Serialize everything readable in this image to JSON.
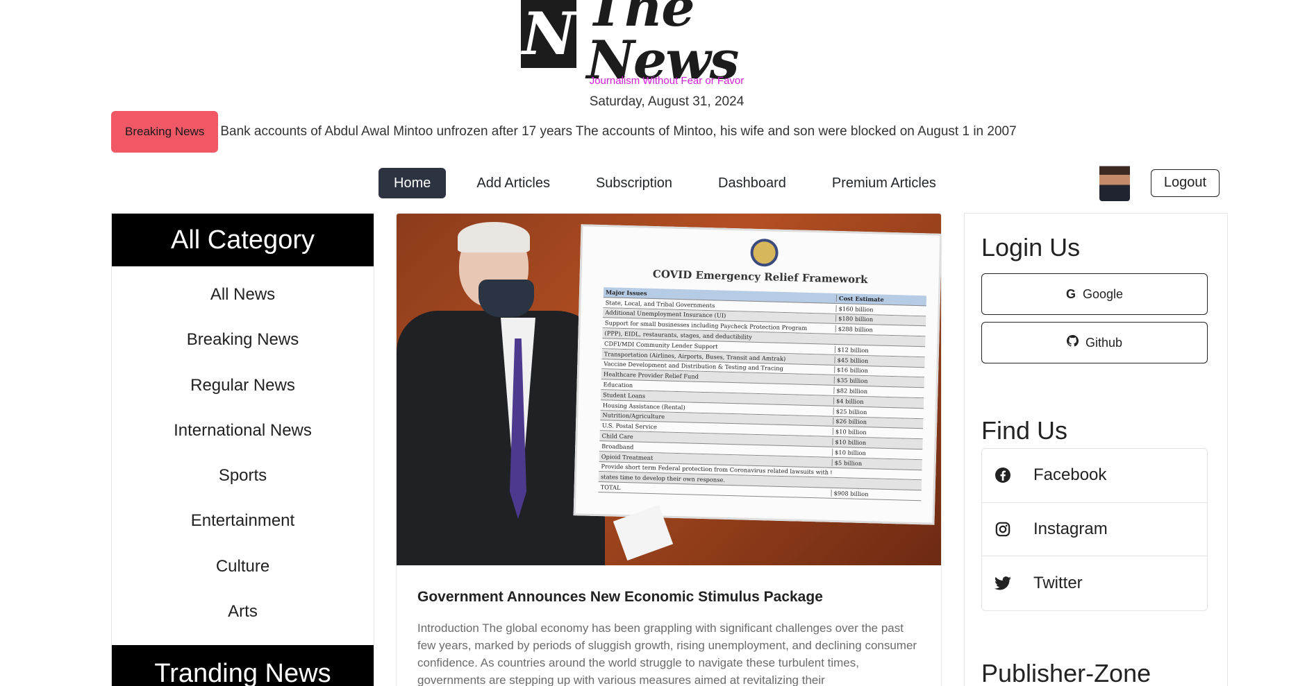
{
  "brand": {
    "logo_letter": "N",
    "logo_name": "The News",
    "tagline": "Journalism Without Fear or Favor",
    "date": "Saturday, August 31, 2024"
  },
  "breaking": {
    "badge": "Breaking News",
    "headline": "Bank accounts of Abdul Awal Mintoo unfrozen after 17 years The accounts of Mintoo, his wife and son were blocked on August 1 in 2007"
  },
  "nav": {
    "items": [
      "Home",
      "Add Articles",
      "Subscription",
      "Dashboard",
      "Premium Articles"
    ],
    "active": "Home",
    "logout_label": "Logout"
  },
  "categories": {
    "heading": "All Category",
    "items": [
      "All News",
      "Breaking News",
      "Regular News",
      "International News",
      "Sports",
      "Entertainment",
      "Culture",
      "Arts"
    ],
    "trending_heading": "Tranding News"
  },
  "article": {
    "image_board": {
      "title": "COVID Emergency Relief Framework",
      "header": [
        "Major Issues",
        "Cost Estimate"
      ],
      "rows": [
        [
          "State, Local, and Tribal Governments",
          "$160 billion"
        ],
        [
          "Additional Unemployment Insurance (UI)",
          "$180 billion"
        ],
        [
          "Support for small businesses including Paycheck Protection Program",
          "$288 billion"
        ],
        [
          "(PPP), EIDL, restaurants, stages, and deductibility",
          ""
        ],
        [
          "CDFI/MDI Community Lender Support",
          "$12 billion"
        ],
        [
          "Transportation (Airlines, Airports, Buses, Transit and Amtrak)",
          "$45 billion"
        ],
        [
          "Vaccine Development and Distribution & Testing and Tracing",
          "$16 billion"
        ],
        [
          "Healthcare Provider Relief Fund",
          "$35 billion"
        ],
        [
          "Education",
          "$82 billion"
        ],
        [
          "Student Loans",
          "$4 billion"
        ],
        [
          "Housing Assistance (Rental)",
          "$25 billion"
        ],
        [
          "Nutrition/Agriculture",
          "$26 billion"
        ],
        [
          "U.S. Postal Service",
          "$10 billion"
        ],
        [
          "Child Care",
          "$10 billion"
        ],
        [
          "Broadband",
          "$10 billion"
        ],
        [
          "Opioid Treatment",
          "$5 billion"
        ],
        [
          "Provide short term Federal protection from Coronavirus related lawsuits with the purpose of giving",
          ""
        ],
        [
          "states time to develop their own response.",
          ""
        ],
        [
          "TOTAL",
          "$908 billion"
        ]
      ]
    },
    "title": "Government Announces New Economic Stimulus Package",
    "excerpt": "Introduction The global economy has been grappling with significant challenges over the past few years, marked by periods of sluggish growth, rising unemployment, and declining consumer confidence. As countries around the world struggle to navigate these turbulent times, governments are stepping up with various measures aimed at revitalizing their"
  },
  "sidebar_right": {
    "login_heading": "Login Us",
    "google_label": "Google",
    "github_label": "Github",
    "find_heading": "Find Us",
    "social": [
      {
        "label": "Facebook",
        "icon": "facebook-icon"
      },
      {
        "label": "Instagram",
        "icon": "instagram-icon"
      },
      {
        "label": "Twitter",
        "icon": "twitter-icon"
      }
    ],
    "publisher_heading": "Publisher-Zone"
  }
}
